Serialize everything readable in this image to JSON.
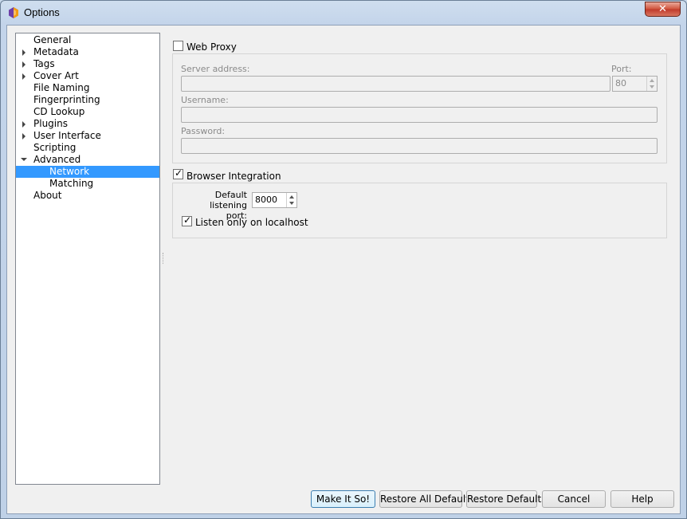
{
  "window": {
    "title": "Options"
  },
  "tree": {
    "items": [
      {
        "label": "General",
        "expander": "none",
        "level": 0,
        "selected": false
      },
      {
        "label": "Metadata",
        "expander": "collapsed",
        "level": 0,
        "selected": false
      },
      {
        "label": "Tags",
        "expander": "collapsed",
        "level": 0,
        "selected": false
      },
      {
        "label": "Cover Art",
        "expander": "collapsed",
        "level": 0,
        "selected": false
      },
      {
        "label": "File Naming",
        "expander": "none",
        "level": 0,
        "selected": false
      },
      {
        "label": "Fingerprinting",
        "expander": "none",
        "level": 0,
        "selected": false
      },
      {
        "label": "CD Lookup",
        "expander": "none",
        "level": 0,
        "selected": false
      },
      {
        "label": "Plugins",
        "expander": "collapsed",
        "level": 0,
        "selected": false
      },
      {
        "label": "User Interface",
        "expander": "collapsed",
        "level": 0,
        "selected": false
      },
      {
        "label": "Scripting",
        "expander": "none",
        "level": 0,
        "selected": false
      },
      {
        "label": "Advanced",
        "expander": "expanded",
        "level": 0,
        "selected": false
      },
      {
        "label": "Network",
        "expander": "none",
        "level": 1,
        "selected": true
      },
      {
        "label": "Matching",
        "expander": "none",
        "level": 1,
        "selected": false
      },
      {
        "label": "About",
        "expander": "none",
        "level": 0,
        "selected": false
      }
    ]
  },
  "proxy": {
    "enabled_label": "Web Proxy",
    "enabled": false,
    "server_label": "Server address:",
    "server_value": "",
    "port_label": "Port:",
    "port_value": "80",
    "username_label": "Username:",
    "username_value": "",
    "password_label": "Password:",
    "password_value": ""
  },
  "browser": {
    "enabled_label": "Browser Integration",
    "enabled": true,
    "port_label_line1": "Default listening",
    "port_label_line2": "port:",
    "port_value": "8000",
    "localhost_label": "Listen only on localhost",
    "localhost_checked": true
  },
  "buttons": {
    "make_it_so": "Make It So!",
    "restore_all": "Restore All Defaults",
    "restore": "Restore Defaults",
    "cancel": "Cancel",
    "help": "Help"
  },
  "colors": {
    "selection": "#3399ff",
    "window_frame": "#c3d4ea",
    "close_button": "#c0392b"
  }
}
